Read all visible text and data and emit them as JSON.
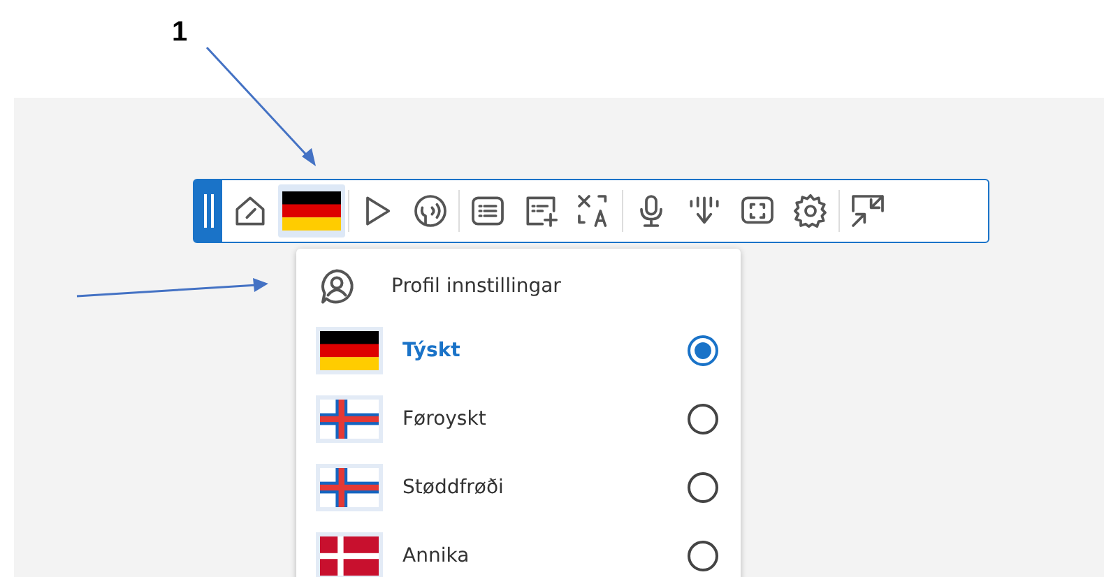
{
  "annotation": {
    "label": "1"
  },
  "toolbar": {
    "language_button": {
      "kind": "de",
      "selected": true
    }
  },
  "menu": {
    "profile_label": "Profil innstillingar",
    "options": [
      {
        "label": "Týskt",
        "kind": "de",
        "selected": true
      },
      {
        "label": "Føroyskt",
        "kind": "fo",
        "selected": false
      },
      {
        "label": "Støddfrøði",
        "kind": "fo",
        "selected": false
      },
      {
        "label": "Annika",
        "kind": "dk",
        "selected": false
      }
    ]
  }
}
